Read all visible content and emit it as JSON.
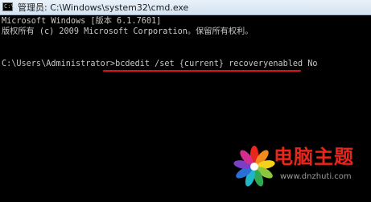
{
  "window": {
    "title": "管理员: C:\\Windows\\system32\\cmd.exe",
    "icon": "cmd-icon",
    "icon_glyph": "C:\\"
  },
  "console": {
    "lines": [
      "Microsoft Windows [版本 6.1.7601]",
      "版权所有 (c) 2009 Microsoft Corporation。保留所有权利。",
      "",
      "C:\\Users\\Administrator>bcdedit /set {current} recoveryenabled No"
    ],
    "highlight_color": "#e0101a"
  },
  "watermark": {
    "title": "电脑主题",
    "url": "www.dnzhuti.com",
    "icon": "flower-logo-icon"
  }
}
